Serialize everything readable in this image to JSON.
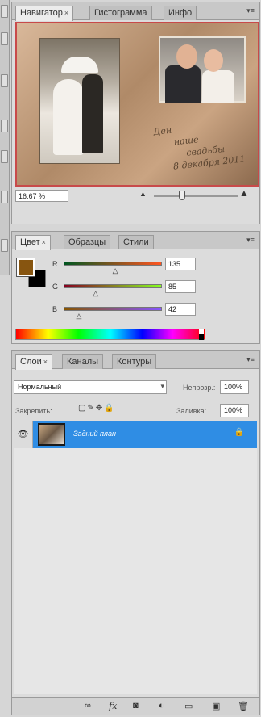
{
  "navigator": {
    "tabs": [
      {
        "label": "Навигатор",
        "close": "×"
      },
      {
        "label": "Гистограмма"
      },
      {
        "label": "Инфо"
      }
    ],
    "image_text": [
      "Ден",
      "наше",
      "свадьбы",
      "8 декабря 2011"
    ],
    "zoom": "16.67 %"
  },
  "color": {
    "tabs": [
      {
        "label": "Цвет",
        "close": "×"
      },
      {
        "label": "Образцы"
      },
      {
        "label": "Стили"
      }
    ],
    "foreground": "#875510",
    "background": "#000000",
    "channels": [
      {
        "label": "R",
        "value": "135",
        "fraction": 0.53
      },
      {
        "label": "G",
        "value": "85",
        "fraction": 0.33
      },
      {
        "label": "B",
        "value": "42",
        "fraction": 0.16
      }
    ]
  },
  "layers": {
    "tabs": [
      {
        "label": "Слои",
        "close": "×"
      },
      {
        "label": "Каналы"
      },
      {
        "label": "Контуры"
      }
    ],
    "blend_mode": "Нормальный",
    "opacity_label": "Непрозр.:",
    "opacity_value": "100%",
    "lock_label": "Закрепить:",
    "fill_label": "Заливка:",
    "fill_value": "100%",
    "layer_name": "Задний план",
    "bottom_icons": [
      "link-icon",
      "fx-icon",
      "mask-icon",
      "adjustment-icon",
      "group-icon",
      "new-layer-icon",
      "trash-icon"
    ]
  }
}
